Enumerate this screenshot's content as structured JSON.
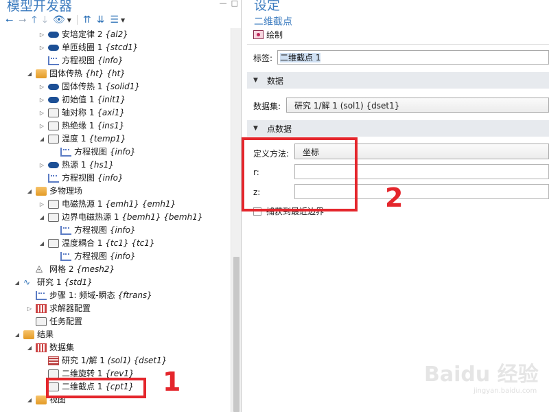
{
  "left_panel": {
    "title": "模型开发器",
    "toolbar": {
      "back": "⭠",
      "forward": "⭢",
      "up": "🡑",
      "down": "🡓",
      "eye": "👁",
      "expand": "⇈",
      "collapse": "⇊",
      "list": "☰"
    },
    "tree": [
      {
        "indent": 3,
        "toggle": "▷",
        "icon": "pill",
        "label": "安培定律 2",
        "tag": "{al2}"
      },
      {
        "indent": 3,
        "toggle": "▷",
        "icon": "pill",
        "label": "单匝线圈 1",
        "tag": "{stcd1}"
      },
      {
        "indent": 3,
        "toggle": "",
        "icon": "plot",
        "label": "方程视图",
        "tag": "{info}"
      },
      {
        "indent": 2,
        "toggle": "◢",
        "icon": "folder",
        "label": "固体传热",
        "tag": "{ht} {ht}"
      },
      {
        "indent": 3,
        "toggle": "▷",
        "icon": "pill",
        "label": "固体传热 1",
        "tag": "{solid1}"
      },
      {
        "indent": 3,
        "toggle": "▷",
        "icon": "pill",
        "label": "初始值 1",
        "tag": "{init1}"
      },
      {
        "indent": 3,
        "toggle": "▷",
        "icon": "box",
        "label": "轴对称 1",
        "tag": "{axi1}"
      },
      {
        "indent": 3,
        "toggle": "▷",
        "icon": "box",
        "label": "热绝缘 1",
        "tag": "{ins1}"
      },
      {
        "indent": 3,
        "toggle": "◢",
        "icon": "box",
        "label": "温度 1",
        "tag": "{temp1}"
      },
      {
        "indent": 4,
        "toggle": "",
        "icon": "plot",
        "label": "方程视图",
        "tag": "{info}"
      },
      {
        "indent": 3,
        "toggle": "▷",
        "icon": "pill",
        "label": "热源 1",
        "tag": "{hs1}"
      },
      {
        "indent": 3,
        "toggle": "",
        "icon": "plot",
        "label": "方程视图",
        "tag": "{info}"
      },
      {
        "indent": 2,
        "toggle": "◢",
        "icon": "folder",
        "label": "多物理场",
        "tag": ""
      },
      {
        "indent": 3,
        "toggle": "▷",
        "icon": "box",
        "label": "电磁热源 1",
        "tag": "{emh1} {emh1}"
      },
      {
        "indent": 3,
        "toggle": "◢",
        "icon": "box",
        "label": "边界电磁热源 1",
        "tag": "{bemh1} {bemh1}"
      },
      {
        "indent": 4,
        "toggle": "",
        "icon": "plot",
        "label": "方程视图",
        "tag": "{info}"
      },
      {
        "indent": 3,
        "toggle": "◢",
        "icon": "box",
        "label": "温度耦合 1",
        "tag": "{tc1} {tc1}"
      },
      {
        "indent": 4,
        "toggle": "",
        "icon": "plot",
        "label": "方程视图",
        "tag": "{info}"
      },
      {
        "indent": 2,
        "toggle": "",
        "icon": "tri",
        "label": "网格 2",
        "tag": "{mesh2}"
      },
      {
        "indent": 1,
        "toggle": "◢",
        "icon": "study",
        "label": "研究 1",
        "tag": "{std1}"
      },
      {
        "indent": 2,
        "toggle": "",
        "icon": "plot",
        "label": "步骤 1: 频域-瞬态",
        "tag": "{ftrans}"
      },
      {
        "indent": 2,
        "toggle": "▷",
        "icon": "grid",
        "label": "求解器配置",
        "tag": ""
      },
      {
        "indent": 2,
        "toggle": "",
        "icon": "box",
        "label": "任务配置",
        "tag": ""
      },
      {
        "indent": 1,
        "toggle": "◢",
        "icon": "folder",
        "label": "结果",
        "tag": ""
      },
      {
        "indent": 2,
        "toggle": "◢",
        "icon": "grid",
        "label": "数据集",
        "tag": ""
      },
      {
        "indent": 3,
        "toggle": "",
        "icon": "grid2",
        "label": "研究 1/解 1",
        "tag": "(sol1) {dset1}"
      },
      {
        "indent": 3,
        "toggle": "",
        "icon": "box",
        "label": "二维旋转 1",
        "tag": "{rev1}"
      },
      {
        "indent": 3,
        "toggle": "",
        "icon": "box",
        "label": "二维截点 1",
        "tag": "{cpt1}"
      },
      {
        "indent": 2,
        "toggle": "◢",
        "icon": "folder",
        "label": "视图",
        "tag": ""
      }
    ]
  },
  "right_panel": {
    "title": "设定",
    "section_name": "二维截点",
    "draw_label": "绘制",
    "label_caption": "标签:",
    "label_value": "二维截点 1",
    "data_section": "数据",
    "dataset_caption": "数据集:",
    "dataset_value": "研究 1/解 1 (sol1) {dset1}",
    "point_section": "点数据",
    "define_caption": "定义方法:",
    "define_value": "坐标",
    "r_caption": "r:",
    "r_value": "",
    "z_caption": "z:",
    "z_value": "",
    "snap_label": "捕获到最近边界"
  },
  "annotations": {
    "num1": "1",
    "num2": "2",
    "color": "#e4262c"
  },
  "watermark": {
    "text": "Baidu 经验",
    "url": "jingyan.baidu.com"
  }
}
